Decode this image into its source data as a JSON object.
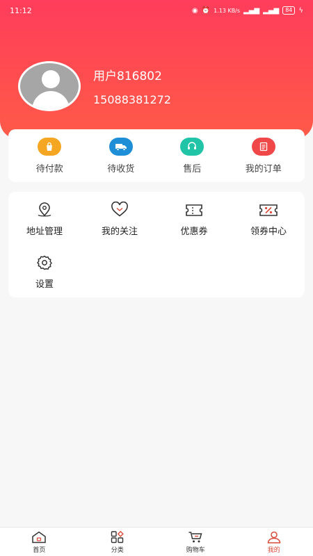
{
  "status_bar": {
    "time": "11:12",
    "network_speed": "1.13 KB/s",
    "battery": "84"
  },
  "profile": {
    "username": "用户816802",
    "phone": "15088381272"
  },
  "orders": [
    {
      "label": "待付款",
      "icon": "shopping-bag-icon",
      "color": "#f5a623"
    },
    {
      "label": "待收货",
      "icon": "truck-icon",
      "color": "#1e8fd6"
    },
    {
      "label": "售后",
      "icon": "headset-icon",
      "color": "#22c4a8"
    },
    {
      "label": "我的订单",
      "icon": "order-list-icon",
      "color": "#f04848"
    }
  ],
  "services": [
    {
      "label": "地址管理",
      "icon": "location-pin-icon"
    },
    {
      "label": "我的关注",
      "icon": "heart-icon"
    },
    {
      "label": "优惠券",
      "icon": "coupon-icon"
    },
    {
      "label": "领券中心",
      "icon": "discount-ticket-icon"
    },
    {
      "label": "设置",
      "icon": "gear-icon"
    }
  ],
  "tabbar": [
    {
      "label": "首页",
      "icon": "home-icon",
      "active": false
    },
    {
      "label": "分类",
      "icon": "category-grid-icon",
      "active": false
    },
    {
      "label": "购物车",
      "icon": "cart-icon",
      "active": false
    },
    {
      "label": "我的",
      "icon": "user-icon",
      "active": true
    }
  ],
  "colors": {
    "brand": "#ff4d4f",
    "tab_active": "#d94a3a"
  }
}
